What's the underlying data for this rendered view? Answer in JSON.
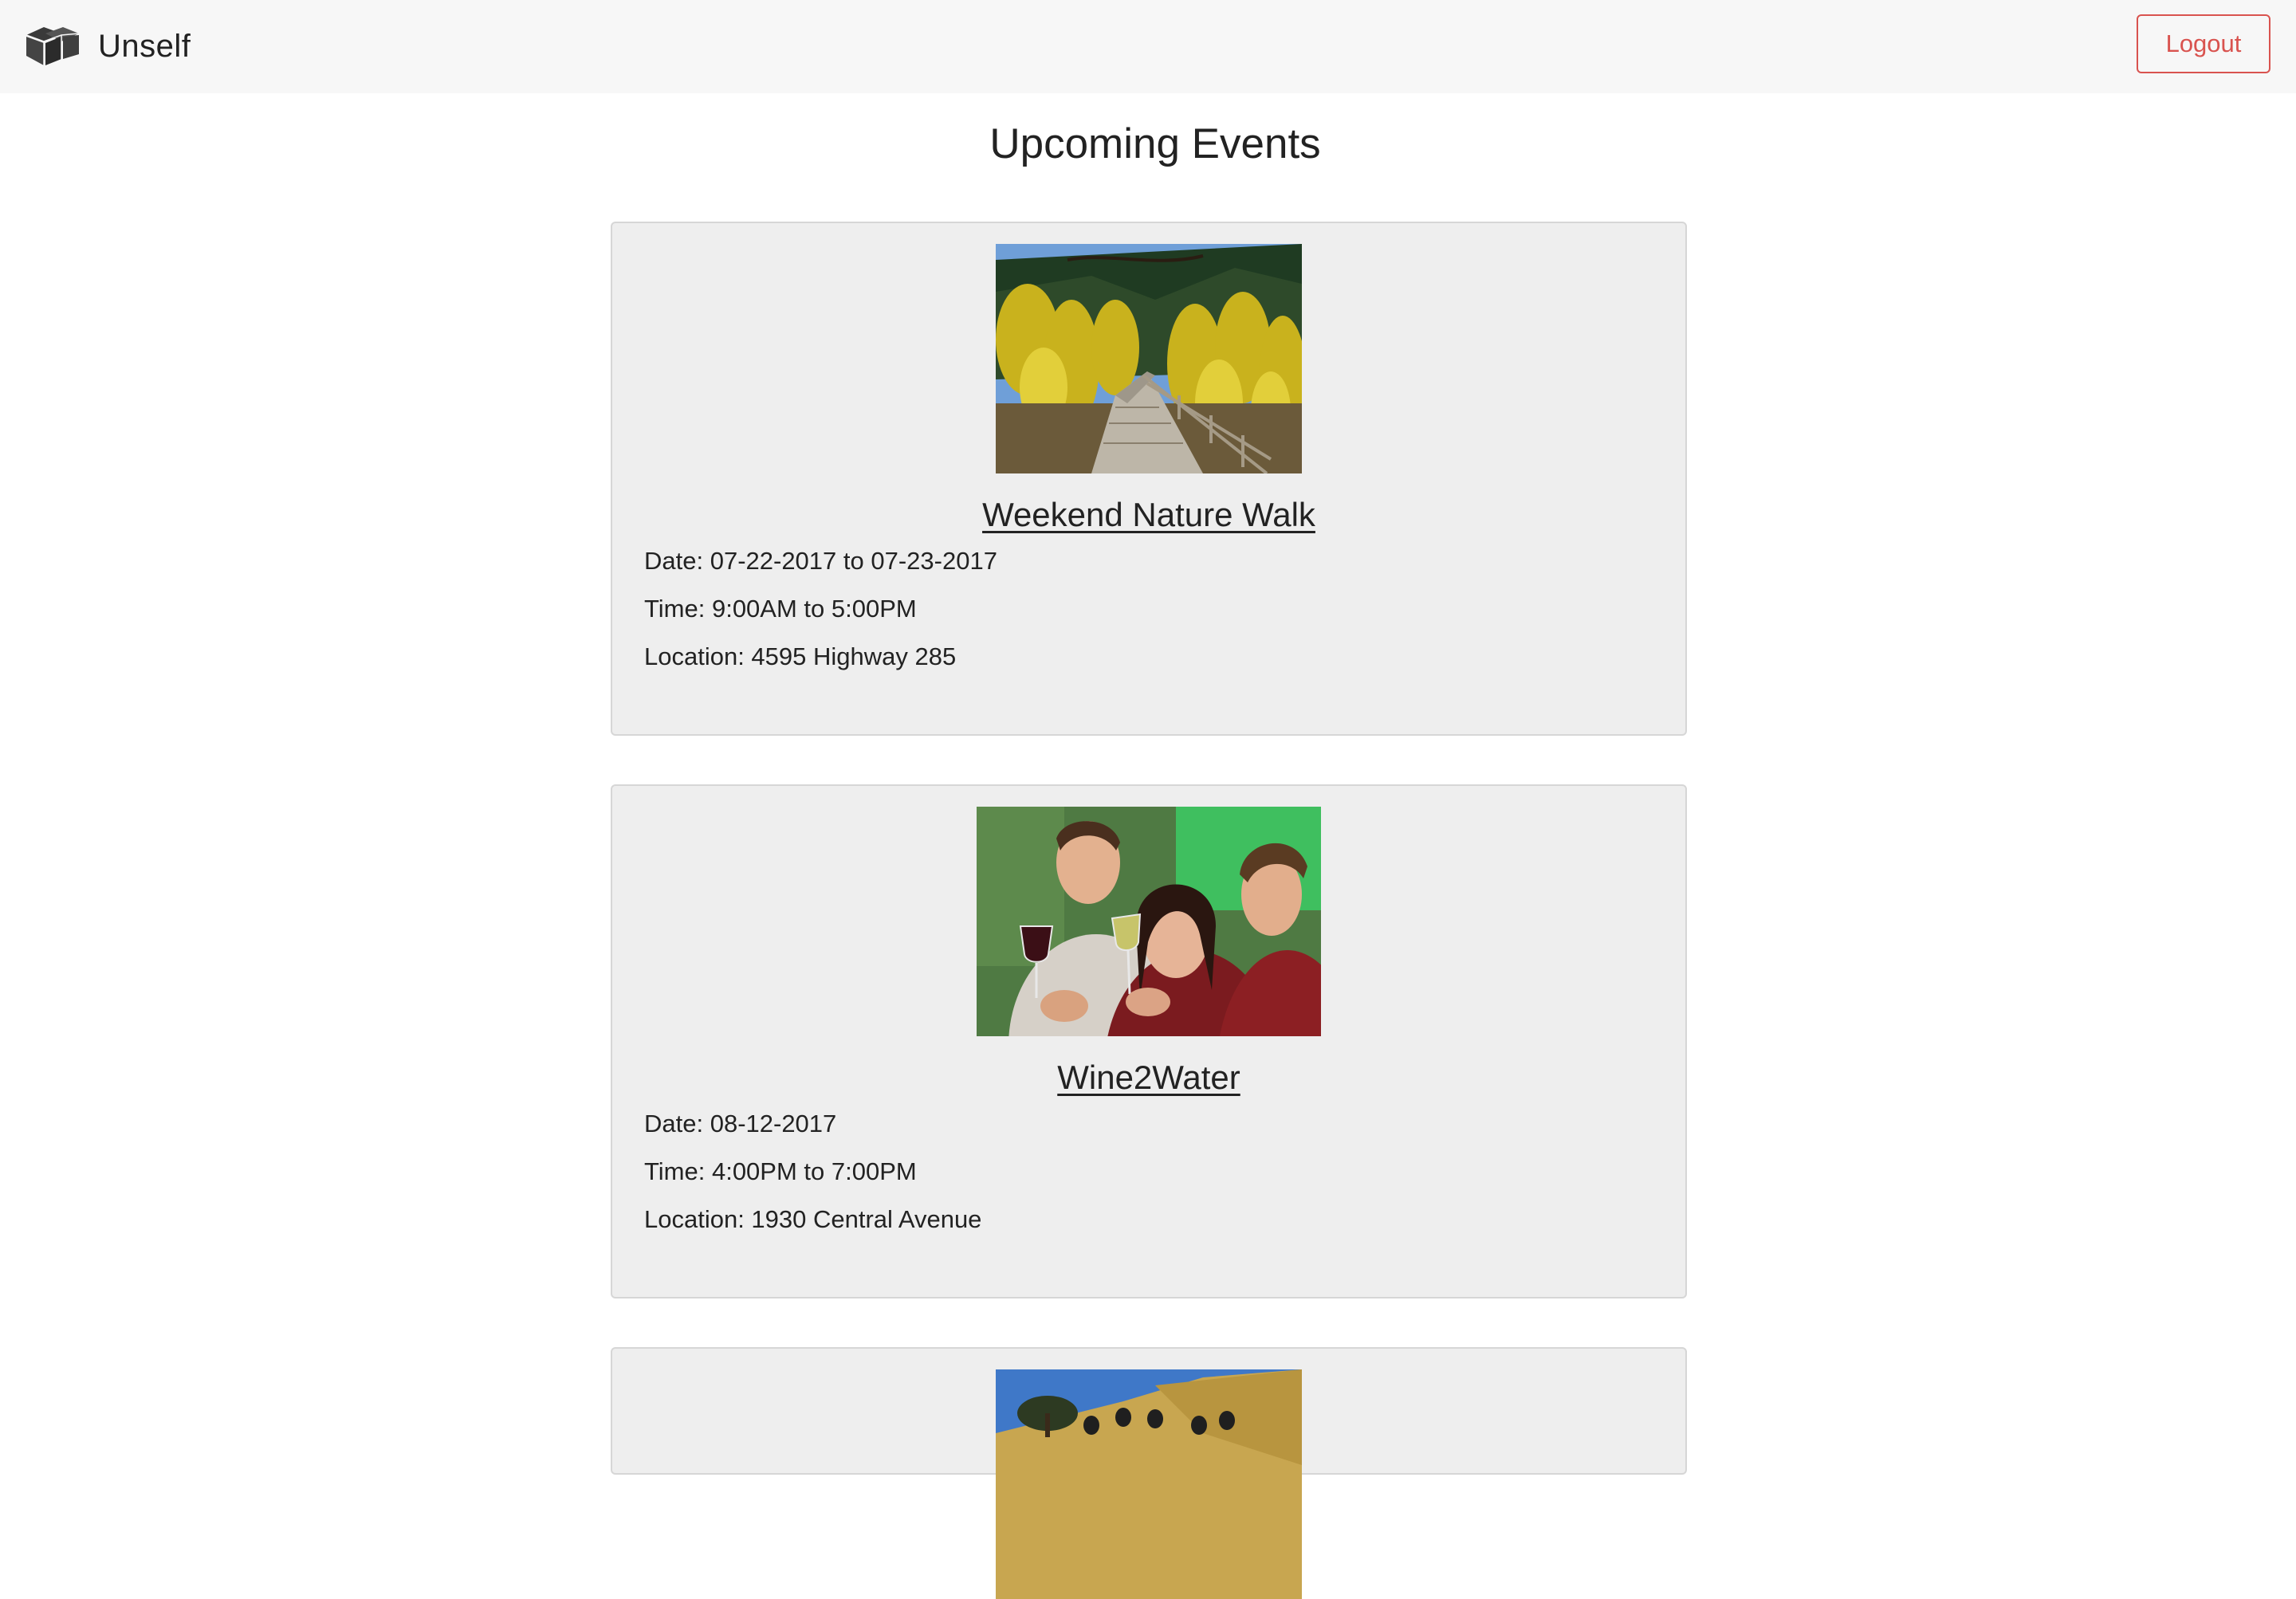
{
  "app": {
    "brand_name": "Unself",
    "logo_icon": "cube-logo-icon",
    "logout_label": "Logout",
    "logout_color": "#d9534f"
  },
  "page": {
    "title": "Upcoming Events"
  },
  "events": [
    {
      "title": "Weekend Nature Walk",
      "image": "autumn-boardwalk-photo",
      "date": "Date: 07-22-2017 to 07-23-2017",
      "time": "Time: 9:00AM to 5:00PM",
      "location": "Location: 4595 Highway 285"
    },
    {
      "title": "Wine2Water",
      "image": "friends-toasting-wine-photo",
      "date": "Date: 08-12-2017",
      "time": "Time: 4:00PM to 7:00PM",
      "location": "Location: 1930 Central Avenue"
    },
    {
      "image": "group-hike-hillside-photo"
    }
  ]
}
